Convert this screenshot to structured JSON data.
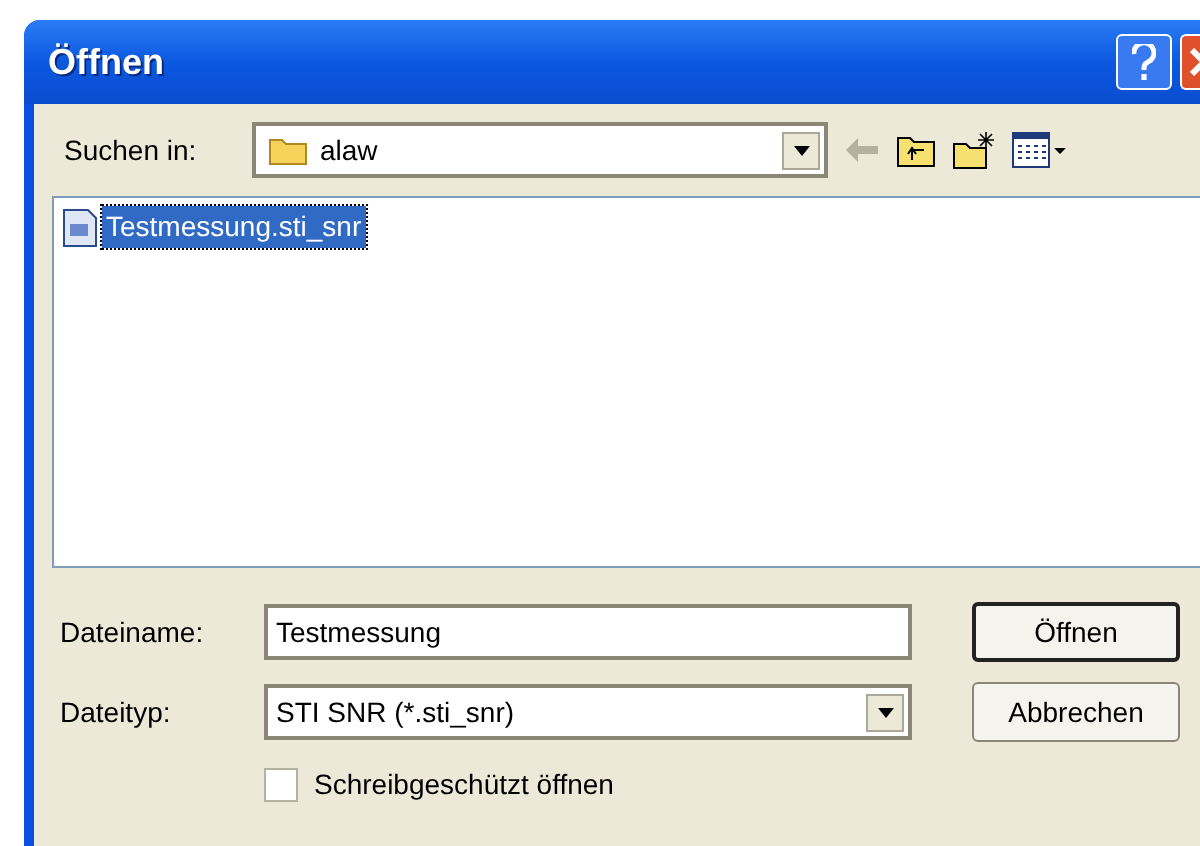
{
  "window": {
    "title": "Öffnen"
  },
  "look_in": {
    "label": "Suchen in:",
    "value": "alaw"
  },
  "files": [
    {
      "name": "Testmessung.sti_snr",
      "selected": true
    }
  ],
  "file_name": {
    "label": "Dateiname:",
    "value": "Testmessung"
  },
  "file_type": {
    "label": "Dateityp:",
    "value": "STI SNR (*.sti_snr)"
  },
  "buttons": [
    "Öffnen",
    "Abbrechen"
  ],
  "read_only": {
    "label": "Schreibgeschützt öffnen",
    "checked": false
  }
}
